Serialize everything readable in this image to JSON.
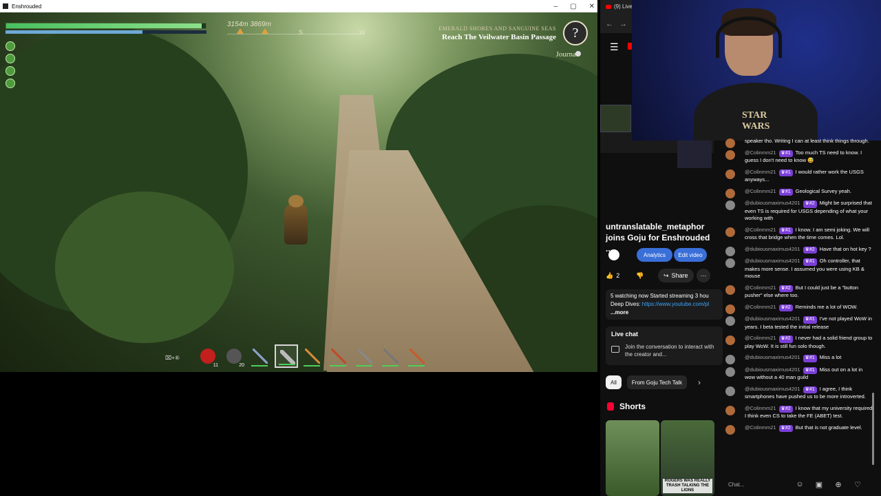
{
  "game": {
    "window_title": "Enshrouded",
    "hud": {
      "health_fraction": 0.98,
      "stamina_fraction": 0.68,
      "compass_distances": "3154m  3869m",
      "compass_dir_s": "S",
      "compass_dir_w": "W",
      "quest_region": "EMERALD SHORES AND SANGUINE SEAS",
      "quest_objective": "Reach The Veilwater Basin Passage",
      "journal_label": "Journal",
      "hotbar_keys": "⌧+⑥",
      "hotbar_count_1": "11",
      "hotbar_count_2": "20"
    }
  },
  "youtube": {
    "tab_title": "(9) Live",
    "video_title": "untranslatable_metaphor joins Goju for Enshrouded ...",
    "analytics_label": "Analytics",
    "edit_video_label": "Edit video",
    "like_count": "2",
    "share_label": "Share",
    "description_line1": "5 watching now  Started streaming 3 hou",
    "description_line2": "Deep Dives: ",
    "description_link": "https://www.youtube.com/pl",
    "description_more": "...more",
    "livechat_title": "Live chat",
    "livechat_sub": "Join the conversation to interact with the creator and...",
    "chip_all": "All",
    "chip_goju": "From Goju Tech Talk",
    "shorts_label": "Shorts",
    "short_caption_2": "ROGERS WAS REALLY TRASH TALKING THE LIONS",
    "webcam_shirt_text": "STAR WARS",
    "chat_placeholder": "Chat...",
    "chat_messages": [
      {
        "author": "",
        "badge": "",
        "text": "speaker tho. Writing I can at least think things through."
      },
      {
        "author": "@Colinmm21",
        "badge": "#1",
        "text": "Too much TS need to know. I guess I don't need to know 😅"
      },
      {
        "author": "@Colinmm21",
        "badge": "#1",
        "text": "I would rather work the USGS anyways..."
      },
      {
        "author": "@Colinmm21",
        "badge": "#1",
        "text": "Geological Survey yeah."
      },
      {
        "author": "@dubiousmaximus4201",
        "badge": "#2",
        "text": "Might be surprised that even TS is required for USGS depending of what your working with"
      },
      {
        "author": "@Colinmm21",
        "badge": "#1",
        "text": "I know. I am semi joking. We will cross that bridge when the time comes. Lol."
      },
      {
        "author": "@dubiousmaximus4201",
        "badge": "#2",
        "text": "Have that on hot key ?"
      },
      {
        "author": "@dubiousmaximus4201",
        "badge": "#1",
        "text": "Oh controller, that makes more sense. I assumed you were using KB & mouse"
      },
      {
        "author": "@Colinmm21",
        "badge": "#2",
        "text": "But I could just be a \"button pusher\" else where too."
      },
      {
        "author": "@Colinmm21",
        "badge": "#2",
        "text": "Reminds me a lot of WOW."
      },
      {
        "author": "@dubiousmaximus4201",
        "badge": "#1",
        "text": "I've not played WoW in years. I beta tested the initial release"
      },
      {
        "author": "@Colinmm21",
        "badge": "#2",
        "text": "I never had a solid friend group to play WoW. It is still fun solo though."
      },
      {
        "author": "@dubiousmaximus4201",
        "badge": "#1",
        "text": "Miss a lot"
      },
      {
        "author": "@dubiousmaximus4201",
        "badge": "#1",
        "text": "Miss out on a lot in wow without a 40 man guild"
      },
      {
        "author": "@dubiousmaximus4201",
        "badge": "#1",
        "text": "I agree, I think smartphones have pushed us to be more introverted."
      },
      {
        "author": "@Colinmm21",
        "badge": "#2",
        "text": "I know that my university required I think even CS to take the FE (ABET) test."
      },
      {
        "author": "@Colinmm21",
        "badge": "#2",
        "text": "But that is not graduate level."
      }
    ]
  },
  "colors": {
    "yt_bg": "#0f0f0f",
    "accent_blue": "#3ea6ff",
    "badge_purple": "#7b3fd6",
    "health_green": "#48c060"
  }
}
